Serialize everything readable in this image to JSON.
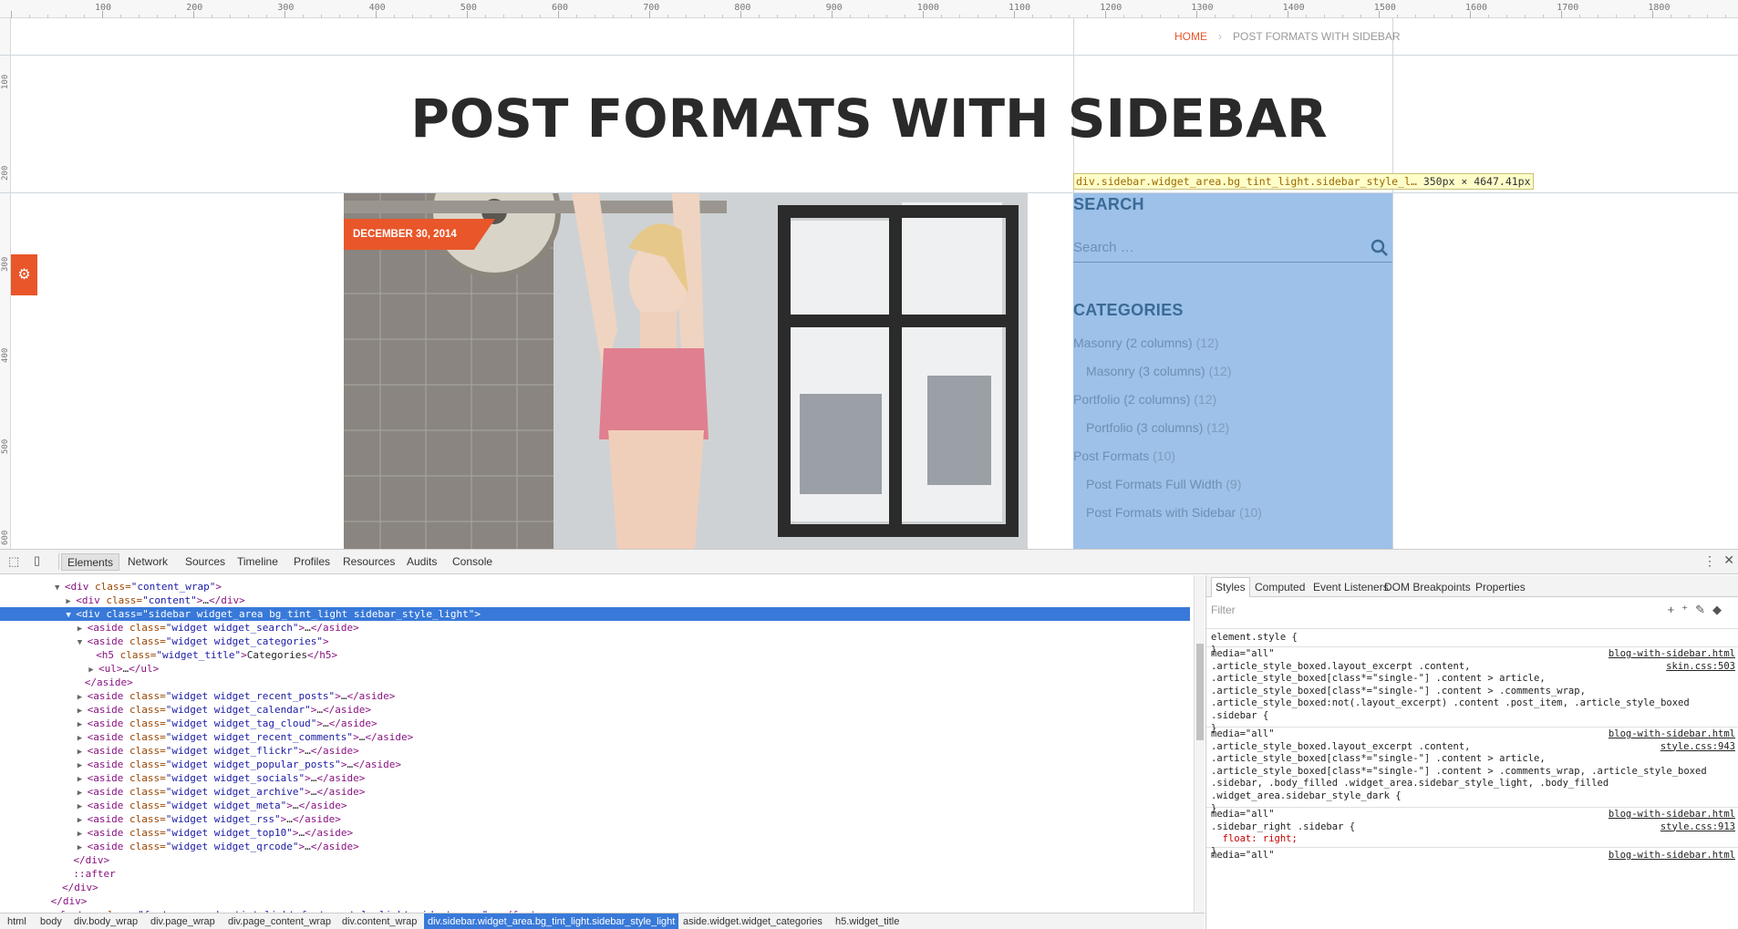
{
  "ruler": {
    "top_labels": [
      "100",
      "200",
      "300",
      "400",
      "500",
      "600",
      "700",
      "800",
      "900",
      "1000",
      "1100",
      "1200",
      "1300",
      "1400",
      "1500",
      "1600",
      "1700",
      "1800"
    ],
    "left_labels": [
      "100",
      "200",
      "300",
      "400",
      "500",
      "600"
    ]
  },
  "breadcrumb": {
    "home": "HOME",
    "sep": "›",
    "current": "POST FORMATS WITH SIDEBAR"
  },
  "page_title": "POST FORMATS WITH SIDEBAR",
  "post": {
    "date": "DECEMBER 30, 2014"
  },
  "inspector_tooltip": {
    "selector": "div.sidebar.widget_area.bg_tint_light.sidebar_style_l…",
    "size": "350px × 4647.41px"
  },
  "sidebar": {
    "search_title": "SEARCH",
    "search_placeholder": "Search …",
    "categories_title": "CATEGORIES",
    "categories": [
      {
        "label": "Masonry (2 columns)",
        "count": "(12)",
        "child": false
      },
      {
        "label": "Masonry (3 columns)",
        "count": "(12)",
        "child": true
      },
      {
        "label": "Portfolio (2 columns)",
        "count": "(12)",
        "child": false
      },
      {
        "label": "Portfolio (3 columns)",
        "count": "(12)",
        "child": true
      },
      {
        "label": "Post Formats",
        "count": "(10)",
        "child": false
      },
      {
        "label": "Post Formats Full Width",
        "count": "(9)",
        "child": true
      },
      {
        "label": "Post Formats with Sidebar",
        "count": "(10)",
        "child": true
      }
    ]
  },
  "devtools": {
    "tabs": [
      "Elements",
      "Network",
      "Sources",
      "Timeline",
      "Profiles",
      "Resources",
      "Audits",
      "Console"
    ],
    "active_tab": "Elements",
    "dom_lines": [
      {
        "indent": 5,
        "arrow": "▼",
        "text": "<div class=\"content_wrap\">",
        "sel": false
      },
      {
        "indent": 6,
        "arrow": "▶",
        "text": "<div class=\"content\">…</div>",
        "sel": false
      },
      {
        "indent": 6,
        "arrow": "▼",
        "text": "<div class=\"sidebar widget_area bg_tint_light sidebar_style_light\">",
        "sel": true
      },
      {
        "indent": 7,
        "arrow": "▶",
        "text": "<aside class=\"widget widget_search\">…</aside>",
        "sel": false
      },
      {
        "indent": 7,
        "arrow": "▼",
        "text": "<aside class=\"widget widget_categories\">",
        "sel": false
      },
      {
        "indent": 8,
        "arrow": "",
        "text": "<h5 class=\"widget_title\">Categories</h5>",
        "sel": false
      },
      {
        "indent": 8,
        "arrow": "▶",
        "text": "<ul>…</ul>",
        "sel": false
      },
      {
        "indent": 7,
        "arrow": "",
        "text": "</aside>",
        "sel": false
      },
      {
        "indent": 7,
        "arrow": "▶",
        "text": "<aside class=\"widget widget_recent_posts\">…</aside>",
        "sel": false
      },
      {
        "indent": 7,
        "arrow": "▶",
        "text": "<aside class=\"widget widget_calendar\">…</aside>",
        "sel": false
      },
      {
        "indent": 7,
        "arrow": "▶",
        "text": "<aside class=\"widget widget_tag_cloud\">…</aside>",
        "sel": false
      },
      {
        "indent": 7,
        "arrow": "▶",
        "text": "<aside class=\"widget widget_recent_comments\">…</aside>",
        "sel": false
      },
      {
        "indent": 7,
        "arrow": "▶",
        "text": "<aside class=\"widget widget_flickr\">…</aside>",
        "sel": false
      },
      {
        "indent": 7,
        "arrow": "▶",
        "text": "<aside class=\"widget widget_popular_posts\">…</aside>",
        "sel": false
      },
      {
        "indent": 7,
        "arrow": "▶",
        "text": "<aside class=\"widget widget_socials\">…</aside>",
        "sel": false
      },
      {
        "indent": 7,
        "arrow": "▶",
        "text": "<aside class=\"widget widget_archive\">…</aside>",
        "sel": false
      },
      {
        "indent": 7,
        "arrow": "▶",
        "text": "<aside class=\"widget widget_meta\">…</aside>",
        "sel": false
      },
      {
        "indent": 7,
        "arrow": "▶",
        "text": "<aside class=\"widget widget_rss\">…</aside>",
        "sel": false
      },
      {
        "indent": 7,
        "arrow": "▶",
        "text": "<aside class=\"widget widget_top10\">…</aside>",
        "sel": false
      },
      {
        "indent": 7,
        "arrow": "▶",
        "text": "<aside class=\"widget widget_qrcode\">…</aside>",
        "sel": false
      },
      {
        "indent": 6,
        "arrow": "",
        "text": "</div>",
        "sel": false
      },
      {
        "indent": 6,
        "arrow": "",
        "text": "::after",
        "sel": false
      },
      {
        "indent": 5,
        "arrow": "",
        "text": "</div>",
        "sel": false
      },
      {
        "indent": 4,
        "arrow": "",
        "text": "</div>",
        "sel": false
      },
      {
        "indent": 4,
        "arrow": "▶",
        "text": "<footer class=\"footer_wrap bg_tint_light footer_style_light widget_area\">…</footer>",
        "sel": false
      }
    ],
    "styles_tabs": [
      "Styles",
      "Computed",
      "Event Listeners",
      "DOM Breakpoints",
      "Properties"
    ],
    "filter_placeholder": "Filter",
    "styles_lines": [
      {
        "text": "element.style {",
        "src": ""
      },
      {
        "text": "}",
        "src": ""
      },
      {
        "text": "media=\"all\"",
        "src": "blog-with-sidebar.html"
      },
      {
        "text": ".article_style_boxed.layout_excerpt .content,",
        "src": "skin.css:503"
      },
      {
        "text": ".article_style_boxed[class*=\"single-\"] .content > article,",
        "src": ""
      },
      {
        "text": ".article_style_boxed[class*=\"single-\"] .content > .comments_wrap,",
        "src": ""
      },
      {
        "text": ".article_style_boxed:not(.layout_excerpt) .content .post_item, .article_style_boxed",
        "src": ""
      },
      {
        "text": ".sidebar {",
        "src": ""
      },
      {
        "text": "}",
        "src": ""
      },
      {
        "text": "media=\"all\"",
        "src": "blog-with-sidebar.html"
      },
      {
        "text": ".article_style_boxed.layout_excerpt .content,",
        "src": "style.css:943"
      },
      {
        "text": ".article_style_boxed[class*=\"single-\"] .content > article,",
        "src": ""
      },
      {
        "text": ".article_style_boxed[class*=\"single-\"] .content > .comments_wrap, .article_style_boxed",
        "src": ""
      },
      {
        "text": ".sidebar, .body_filled .widget_area.sidebar_style_light, .body_filled",
        "src": ""
      },
      {
        "text": ".widget_area.sidebar_style_dark {",
        "src": ""
      },
      {
        "text": "}",
        "src": ""
      },
      {
        "text": "media=\"all\"",
        "src": "blog-with-sidebar.html"
      },
      {
        "text": ".sidebar_right .sidebar {",
        "src": "style.css:913"
      },
      {
        "text": "  float: right;",
        "src": ""
      },
      {
        "text": "}",
        "src": ""
      },
      {
        "text": "media=\"all\"",
        "src": "blog-with-sidebar.html"
      }
    ],
    "crumbs": [
      "html",
      "body",
      "div.body_wrap",
      "div.page_wrap",
      "div.page_content_wrap",
      "div.content_wrap",
      "div.sidebar.widget_area.bg_tint_light.sidebar_style_light",
      "aside.widget.widget_categories",
      "h5.widget_title"
    ],
    "selected_crumb": 6
  },
  "colors": {
    "accent": "#e8562a",
    "highlight": "#9dc1e8",
    "selection": "#3879d9"
  }
}
